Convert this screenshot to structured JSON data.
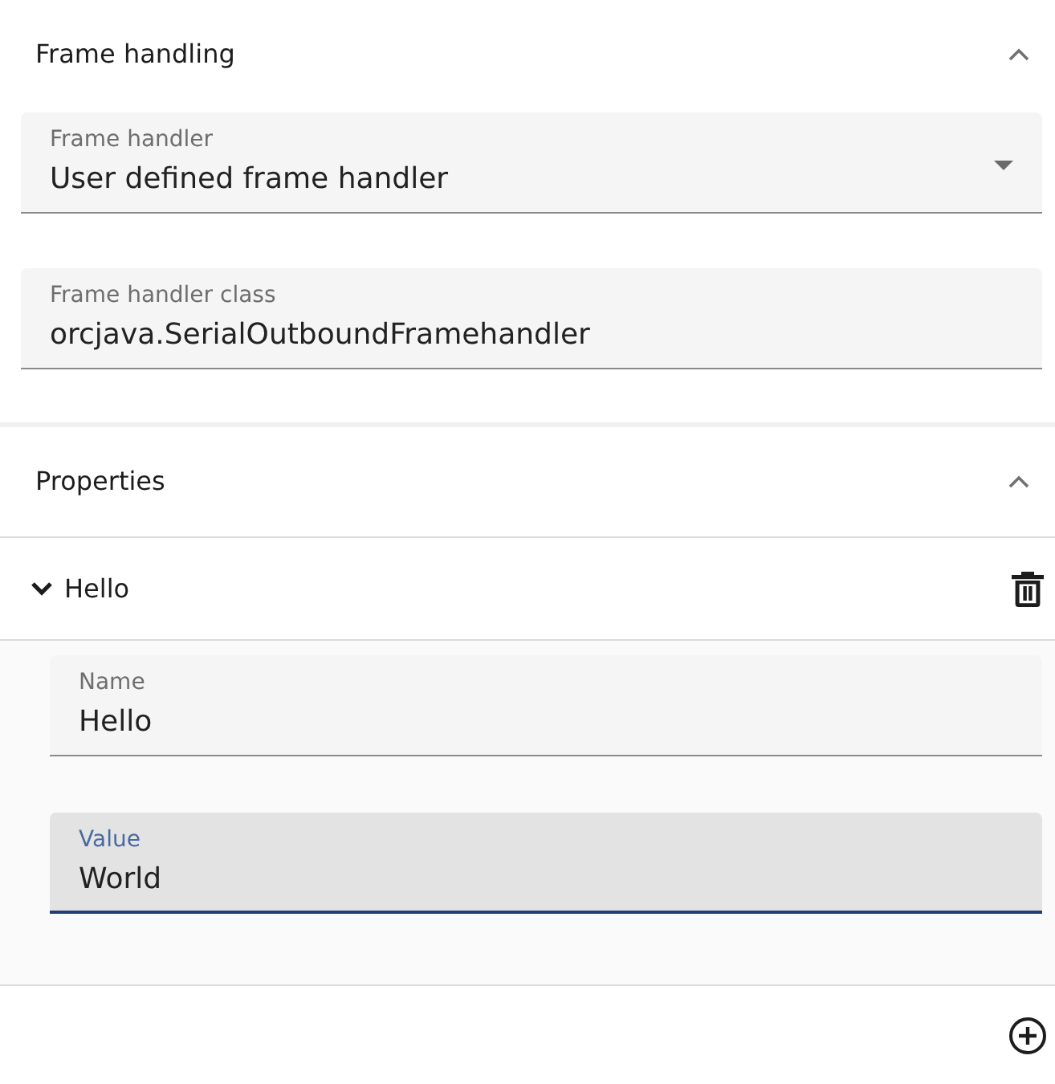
{
  "frame_handling": {
    "title": "Frame handling",
    "expanded": true,
    "fields": [
      {
        "kind": "select",
        "label": "Frame handler",
        "value": "User defined frame handler",
        "focused": false
      },
      {
        "kind": "text",
        "label": "Frame handler class",
        "value": "orcjava.SerialOutboundFramehandler",
        "focused": false
      }
    ]
  },
  "properties": {
    "title": "Properties",
    "expanded": true,
    "items": [
      {
        "name": "Hello",
        "expanded": true,
        "fields": [
          {
            "kind": "text",
            "label": "Name",
            "value": "Hello",
            "focused": false
          },
          {
            "kind": "text",
            "label": "Value",
            "value": "World",
            "focused": true
          }
        ]
      }
    ]
  }
}
